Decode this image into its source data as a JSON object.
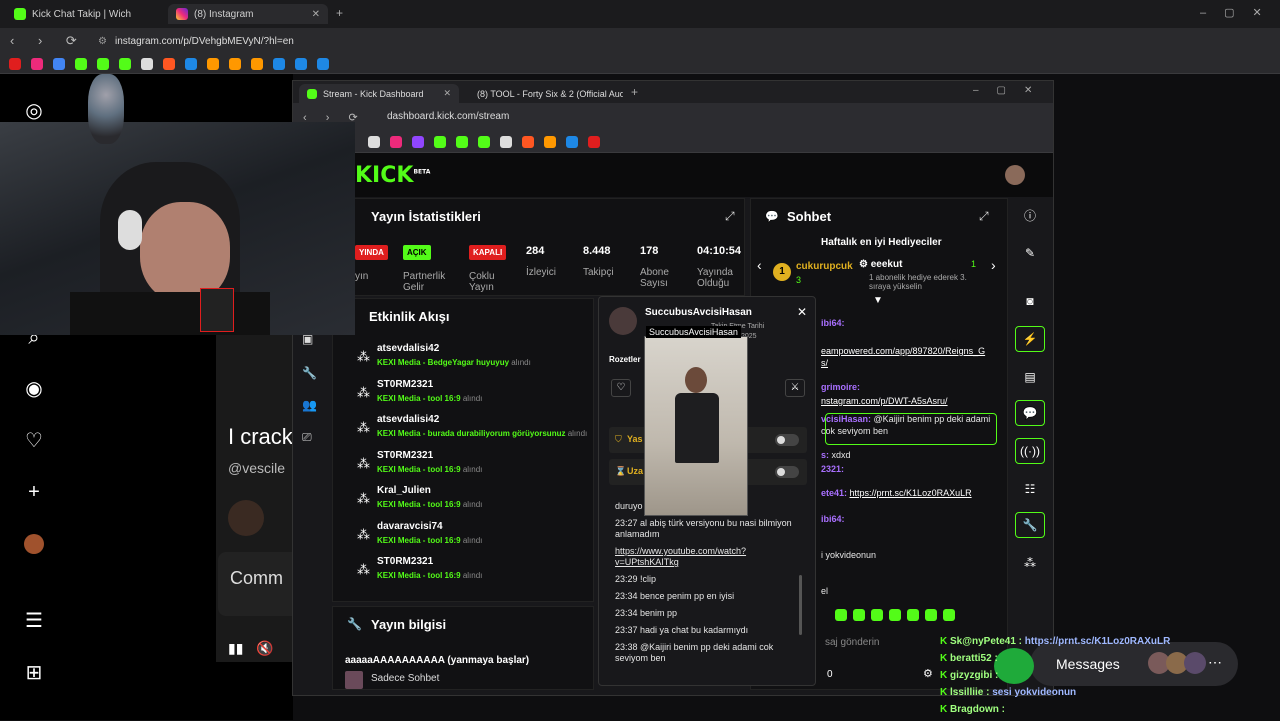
{
  "outer_browser": {
    "tabs": [
      {
        "label": "Kick Chat Takip | Wich"
      },
      {
        "label": "(8) Instagram"
      }
    ],
    "url": "instagram.com/p/DVehgbMEVyN/?hl=en"
  },
  "instagram": {
    "post_text": "I crack",
    "handle": "@vescile",
    "comment_label": "Comm"
  },
  "inner_browser": {
    "tabs": [
      {
        "label": "Stream - Kick Dashboard"
      },
      {
        "label": "(8) TOOL - Forty Six & 2 (Official Audi"
      }
    ],
    "url": "dashboard.kick.com/stream"
  },
  "kick": {
    "logo": "KICK",
    "logo_sup": "BETA",
    "stats": {
      "title": "Yayın İstatistikleri",
      "badges": [
        {
          "text": "YINDA",
          "color": "#e01e1e",
          "label": "yın"
        },
        {
          "text": "AÇIK",
          "color": "#53fc18",
          "label": "Partnerlik Gelir"
        },
        {
          "text": "KAPALI",
          "color": "#e01e1e",
          "label": "Çoklu Yayın"
        }
      ],
      "numbers": [
        {
          "value": "284",
          "label": "İzleyici"
        },
        {
          "value": "8.448",
          "label": "Takipçi"
        },
        {
          "value": "178",
          "label": "Abone Sayısı"
        },
        {
          "value": "04:10:54",
          "label": "Yayında Olduğu"
        }
      ]
    },
    "activity": {
      "title": "Etkinlik Akışı",
      "events": [
        {
          "user": "atsevdalisi42",
          "item": "KEXI Media - BedgeYagar huyuyuy",
          "suffix": "alındı"
        },
        {
          "user": "ST0RM2321",
          "item": "KEXI Media - tool 16:9",
          "suffix": "alındı"
        },
        {
          "user": "atsevdalisi42",
          "item": "KEXI Media - burada durabiliyorum görüyorsunuz",
          "suffix": "alındı"
        },
        {
          "user": "ST0RM2321",
          "item": "KEXI Media - tool 16:9",
          "suffix": "alındı"
        },
        {
          "user": "Kral_Julien",
          "item": "KEXI Media - tool 16:9",
          "suffix": "alındı"
        },
        {
          "user": "davaravcisi74",
          "item": "KEXI Media - tool 16:9",
          "suffix": "alındı"
        },
        {
          "user": "ST0RM2321",
          "item": "KEXI Media - tool 16:9",
          "suffix": "alındı"
        }
      ]
    },
    "stream_info": {
      "title": "Yayın bilgisi",
      "stream_title": "aaaaaAAAAAAAAAA (yanmaya başlar)",
      "category": "Sadece Sohbet"
    },
    "chat": {
      "title": "Sohbet",
      "gifters_title": "Haftalık en iyi Hediyeciler",
      "gifter1": "cukurupcuk",
      "gifter1_count": "3",
      "gifter2": "eeekut",
      "gifter2_count": "1",
      "gifter2_note": "1 abonelik hediye ederek 3. sıraya yükselin",
      "lines": [
        {
          "user": "ibi64:",
          "text": ""
        },
        {
          "user": "",
          "text": "eampowered.com/app/897820/Reigns_G s/"
        },
        {
          "user": "grimoire:",
          "text": ""
        },
        {
          "user": "",
          "text": "nstagram.com/p/DWT-A5sAsru/"
        },
        {
          "user": "vcisiHasan:",
          "text": "@Kaijiri benim pp deki adami cok seviyom ben"
        },
        {
          "user": "s:",
          "text": "xdxd"
        },
        {
          "user": "2321:",
          "text": ""
        },
        {
          "user": "ete41:",
          "text": "https://prnt.sc/K1Loz0RAXuLR"
        },
        {
          "user": "ibi64:",
          "text": ""
        },
        {
          "user": "",
          "text": "i yokvideonun"
        },
        {
          "user": "",
          "text": "el"
        }
      ],
      "input_placeholder": "saj gönderin",
      "count": "0"
    },
    "popup": {
      "username": "SuccubusAvcisiHasan",
      "tooltip": "SuccubusAvcisiHasan",
      "follow_date_label": "Takip Etme Tarihi",
      "follow_date": "2025",
      "badges_label": "Rozetler",
      "row1": "Yas",
      "row2": "Uza",
      "messages": [
        "duruyo ... rsiyonu dizisinden iyid",
        "23:27 al abiş türk versiyonu bu nasi bilmiyon anlamadım",
        "https://www.youtube.com/watch?v=UPtshKAITkg",
        "23:29 !clip",
        "23:34 bence penim pp en iyisi",
        "23:34 benim pp",
        "23:37 hadi ya chat bu kadarmıydı",
        "23:38 @Kaijiri benim pp deki adami cok seviyom ben"
      ]
    }
  },
  "overlay_chat": {
    "lines": [
      {
        "user": "Sk@nyPete41 :",
        "text": "https://prnt.sc/K1Loz0RAXuLR"
      },
      {
        "user": "beratti52 :",
        "text": ""
      },
      {
        "user": "gizyzgibi :",
        "text": ""
      },
      {
        "user": "lssilliie :",
        "text": "sesi yokvideonun"
      },
      {
        "user": "Bragdown :",
        "text": ""
      }
    ],
    "messages_label": "Messages"
  },
  "colors": {
    "kick_green": "#53fc18",
    "red": "#e01e1e"
  }
}
